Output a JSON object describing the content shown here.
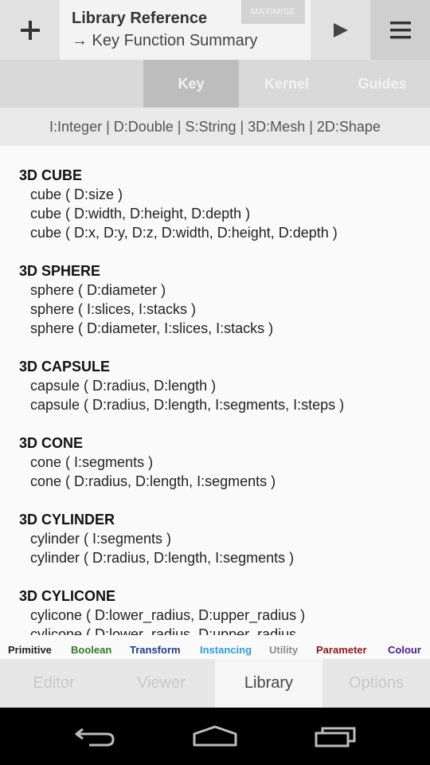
{
  "header": {
    "title": "Library Reference",
    "subtitle": "→ Key Function Summary",
    "maximise_label": "MAXIMISE",
    "add_icon": "plus-icon",
    "run_icon": "play-icon",
    "menu_icon": "hamburger-menu-icon"
  },
  "tabs": [
    {
      "label": "Key",
      "active": true
    },
    {
      "label": "Kernel",
      "active": false
    },
    {
      "label": "Guides",
      "active": false
    }
  ],
  "legend": "I:Integer | D:Double | S:String | 3D:Mesh | 2D:Shape",
  "sections": [
    {
      "title": "3D CUBE",
      "lines": [
        "cube ( D:size )",
        "cube ( D:width, D:height, D:depth )",
        "cube ( D:x, D:y, D:z, D:width, D:height, D:depth )"
      ]
    },
    {
      "title": "3D SPHERE",
      "lines": [
        "sphere ( D:diameter )",
        "sphere ( I:slices, I:stacks )",
        "sphere ( D:diameter, I:slices, I:stacks )"
      ]
    },
    {
      "title": "3D CAPSULE",
      "lines": [
        "capsule ( D:radius, D:length )",
        "capsule ( D:radius, D:length, I:segments, I:steps )"
      ]
    },
    {
      "title": "3D CONE",
      "lines": [
        "cone ( I:segments )",
        "cone ( D:radius, D:length, I:segments )"
      ]
    },
    {
      "title": "3D CYLINDER",
      "lines": [
        "cylinder ( I:segments )",
        "cylinder ( D:radius, D:length, I:segments )"
      ]
    },
    {
      "title": "3D CYLICONE",
      "lines": [
        "cylicone ( D:lower_radius, D:upper_radius )",
        "cylicone ( D:lower_radius, D:upper_radius,"
      ]
    }
  ],
  "categories": [
    {
      "label": "Primitive",
      "color": "#222222"
    },
    {
      "label": "Boolean",
      "color": "#2e7d1e"
    },
    {
      "label": "Transform",
      "color": "#1b3f8b"
    },
    {
      "label": "Instancing",
      "color": "#2a9fd8"
    },
    {
      "label": "Utility",
      "color": "#8a8a8a"
    },
    {
      "label": "Parameter",
      "color": "#8b1a1a"
    },
    {
      "label": "Colour",
      "color": "#4b1a8b"
    }
  ],
  "bottom_tabs": [
    {
      "label": "Editor",
      "active": false
    },
    {
      "label": "Viewer",
      "active": false
    },
    {
      "label": "Library",
      "active": true
    },
    {
      "label": "Options",
      "active": false
    }
  ],
  "nav": {
    "back_icon": "back-arrow-icon",
    "home_icon": "home-icon",
    "recents_icon": "recent-apps-icon"
  }
}
